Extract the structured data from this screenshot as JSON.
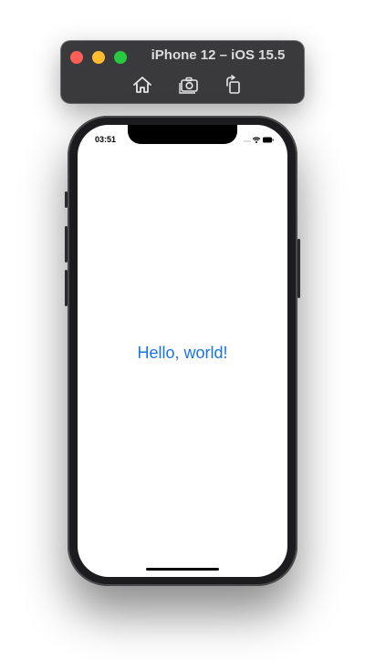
{
  "simulator": {
    "title": "iPhone 12 – iOS 15.5",
    "toolbar": {
      "icons": [
        "home-icon",
        "screenshot-icon",
        "rotate-icon"
      ]
    },
    "traffic_lights": {
      "close": "#ff5f57",
      "minimize": "#febc2e",
      "maximize": "#28c840"
    }
  },
  "status_bar": {
    "time": "03:51",
    "icons": [
      "signal-icon",
      "wifi-icon",
      "battery-icon"
    ]
  },
  "app": {
    "message": "Hello, world!",
    "message_color": "#1a73e8"
  }
}
